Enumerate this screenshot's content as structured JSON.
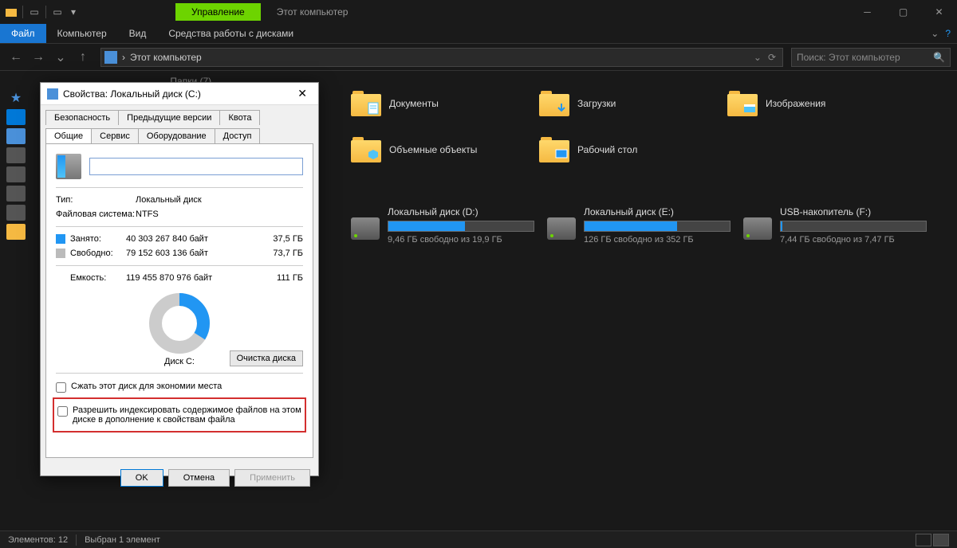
{
  "titlebar": {
    "context_label": "Управление",
    "window_title": "Этот компьютер"
  },
  "menubar": {
    "file": "Файл",
    "computer": "Компьютер",
    "view": "Вид",
    "context": "Средства работы с дисками"
  },
  "addressbar": {
    "path": "Этот компьютер",
    "separator": "›"
  },
  "search": {
    "placeholder": "Поиск: Этот компьютер"
  },
  "section_folders": "Папки (7)",
  "folders": [
    {
      "label": "Документы",
      "overlay": "doc"
    },
    {
      "label": "Загрузки",
      "overlay": "down"
    },
    {
      "label": "Изображения",
      "overlay": "img"
    },
    {
      "label": "Объемные объекты",
      "overlay": "3d"
    },
    {
      "label": "Рабочий стол",
      "overlay": "desk"
    }
  ],
  "drives": [
    {
      "name": "Локальный диск (D:)",
      "free": "9,46 ГБ свободно из 19,9 ГБ",
      "fill_pct": 53
    },
    {
      "name": "Локальный диск (E:)",
      "free": "126 ГБ свободно из 352 ГБ",
      "fill_pct": 64
    },
    {
      "name": "USB-накопитель (F:)",
      "free": "7,44 ГБ свободно из 7,47 ГБ",
      "fill_pct": 1
    }
  ],
  "statusbar": {
    "count": "Элементов: 12",
    "selected": "Выбран 1 элемент"
  },
  "dialog": {
    "title": "Свойства: Локальный диск (C:)",
    "tabs_row1": [
      "Безопасность",
      "Предыдущие версии",
      "Квота"
    ],
    "tabs_row2": [
      "Общие",
      "Сервис",
      "Оборудование",
      "Доступ"
    ],
    "active_tab": "Общие",
    "label_input": "",
    "type_label": "Тип:",
    "type_value": "Локальный диск",
    "fs_label": "Файловая система:",
    "fs_value": "NTFS",
    "used_label": "Занято:",
    "used_bytes": "40 303 267 840 байт",
    "used_gb": "37,5 ГБ",
    "free_label": "Свободно:",
    "free_bytes": "79 152 603 136 байт",
    "free_gb": "73,7 ГБ",
    "capacity_label": "Емкость:",
    "capacity_bytes": "119 455 870 976 байт",
    "capacity_gb": "111 ГБ",
    "disk_label": "Диск C:",
    "cleanup_btn": "Очистка диска",
    "compress_label": "Сжать этот диск для экономии места",
    "index_label": "Разрешить индексировать содержимое файлов на этом диске в дополнение к свойствам файла",
    "ok": "OK",
    "cancel": "Отмена",
    "apply": "Применить",
    "used_pct": 34
  }
}
